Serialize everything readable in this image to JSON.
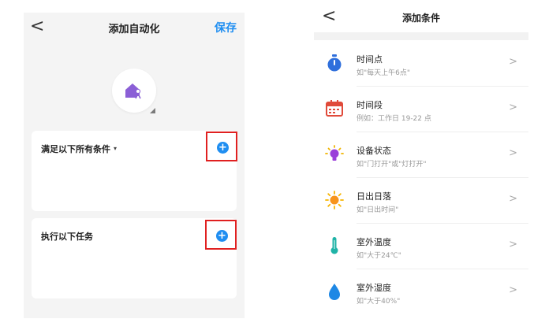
{
  "left": {
    "header": {
      "back_glyph": "<",
      "title": "添加自动化",
      "save_label": "保存"
    },
    "avatar": {
      "icon": "home-person-icon",
      "color": "#8b5fd6"
    },
    "conditions_card": {
      "title": "满足以下所有条件",
      "caret": "▾",
      "add_glyph": "+"
    },
    "tasks_card": {
      "title": "执行以下任务",
      "add_glyph": "+"
    },
    "colors": {
      "accent": "#1f8ef1",
      "highlight_box": "#e02020"
    }
  },
  "right": {
    "header": {
      "back_glyph": "<",
      "title": "添加条件"
    },
    "items": [
      {
        "label": "时间点",
        "sub": "如\"每天上午6点\"",
        "icon": "stopwatch-icon",
        "chevron": ">"
      },
      {
        "label": "时间段",
        "sub": "例如：工作日 19-22 点",
        "icon": "calendar-icon",
        "chevron": ">"
      },
      {
        "label": "设备状态",
        "sub": "如\"门打开\"或\"灯打开\"",
        "icon": "lightbulb-icon",
        "chevron": ">"
      },
      {
        "label": "日出日落",
        "sub": "如\"日出时间\"",
        "icon": "sun-icon",
        "chevron": ">"
      },
      {
        "label": "室外温度",
        "sub": "如\"大于24℃\"",
        "icon": "thermometer-icon",
        "chevron": ">"
      },
      {
        "label": "室外湿度",
        "sub": "如\"大于40%\"",
        "icon": "water-drop-icon",
        "chevron": ">"
      }
    ]
  }
}
